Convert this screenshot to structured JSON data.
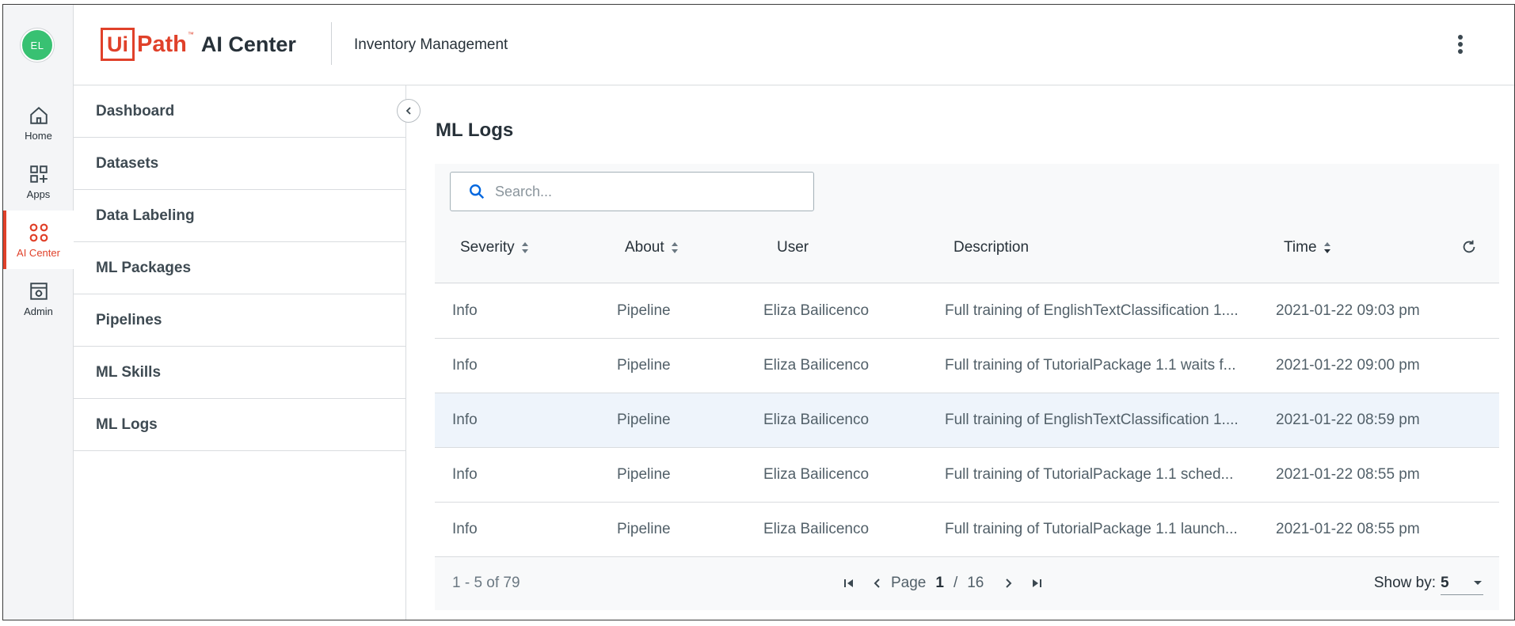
{
  "user": {
    "initials": "EL"
  },
  "rail": {
    "items": [
      {
        "label": "Home",
        "icon": "home-icon"
      },
      {
        "label": "Apps",
        "icon": "apps-icon"
      },
      {
        "label": "AI Center",
        "icon": "ai-center-icon",
        "active": true
      },
      {
        "label": "Admin",
        "icon": "admin-icon"
      }
    ]
  },
  "header": {
    "logo": {
      "ui": "Ui",
      "path": "Path",
      "tm": "™",
      "product": "AI Center"
    },
    "app_title": "Inventory Management"
  },
  "nav": {
    "items": [
      {
        "label": "Dashboard"
      },
      {
        "label": "Datasets"
      },
      {
        "label": "Data Labeling"
      },
      {
        "label": "ML Packages"
      },
      {
        "label": "Pipelines"
      },
      {
        "label": "ML Skills"
      },
      {
        "label": "ML Logs"
      }
    ]
  },
  "main": {
    "title": "ML Logs",
    "search": {
      "placeholder": "Search...",
      "value": ""
    },
    "columns": [
      {
        "label": "Severity",
        "sortable": true
      },
      {
        "label": "About",
        "sortable": true
      },
      {
        "label": "User",
        "sortable": false
      },
      {
        "label": "Description",
        "sortable": false
      },
      {
        "label": "Time",
        "sortable": true,
        "sort": "desc"
      }
    ],
    "rows": [
      {
        "severity": "Info",
        "about": "Pipeline",
        "user": "Eliza Bailicenco",
        "description": "Full training of EnglishTextClassification 1....",
        "time": "2021-01-22 09:03 pm"
      },
      {
        "severity": "Info",
        "about": "Pipeline",
        "user": "Eliza Bailicenco",
        "description": "Full training of TutorialPackage 1.1 waits f...",
        "time": "2021-01-22 09:00 pm"
      },
      {
        "severity": "Info",
        "about": "Pipeline",
        "user": "Eliza Bailicenco",
        "description": "Full training of EnglishTextClassification 1....",
        "time": "2021-01-22 08:59 pm",
        "selected": true
      },
      {
        "severity": "Info",
        "about": "Pipeline",
        "user": "Eliza Bailicenco",
        "description": "Full training of TutorialPackage 1.1 sched...",
        "time": "2021-01-22 08:55 pm"
      },
      {
        "severity": "Info",
        "about": "Pipeline",
        "user": "Eliza Bailicenco",
        "description": "Full training of TutorialPackage 1.1 launch...",
        "time": "2021-01-22 08:55 pm"
      }
    ],
    "footer": {
      "range": "1 - 5 of 79",
      "page_label": "Page",
      "current_page": "1",
      "separator": "/",
      "total_pages": "16",
      "show_by_label": "Show by:",
      "show_by_value": "5"
    }
  },
  "colors": {
    "brand": "#e0412a",
    "avatar": "#38c172",
    "selected_row": "#eef4fb"
  }
}
